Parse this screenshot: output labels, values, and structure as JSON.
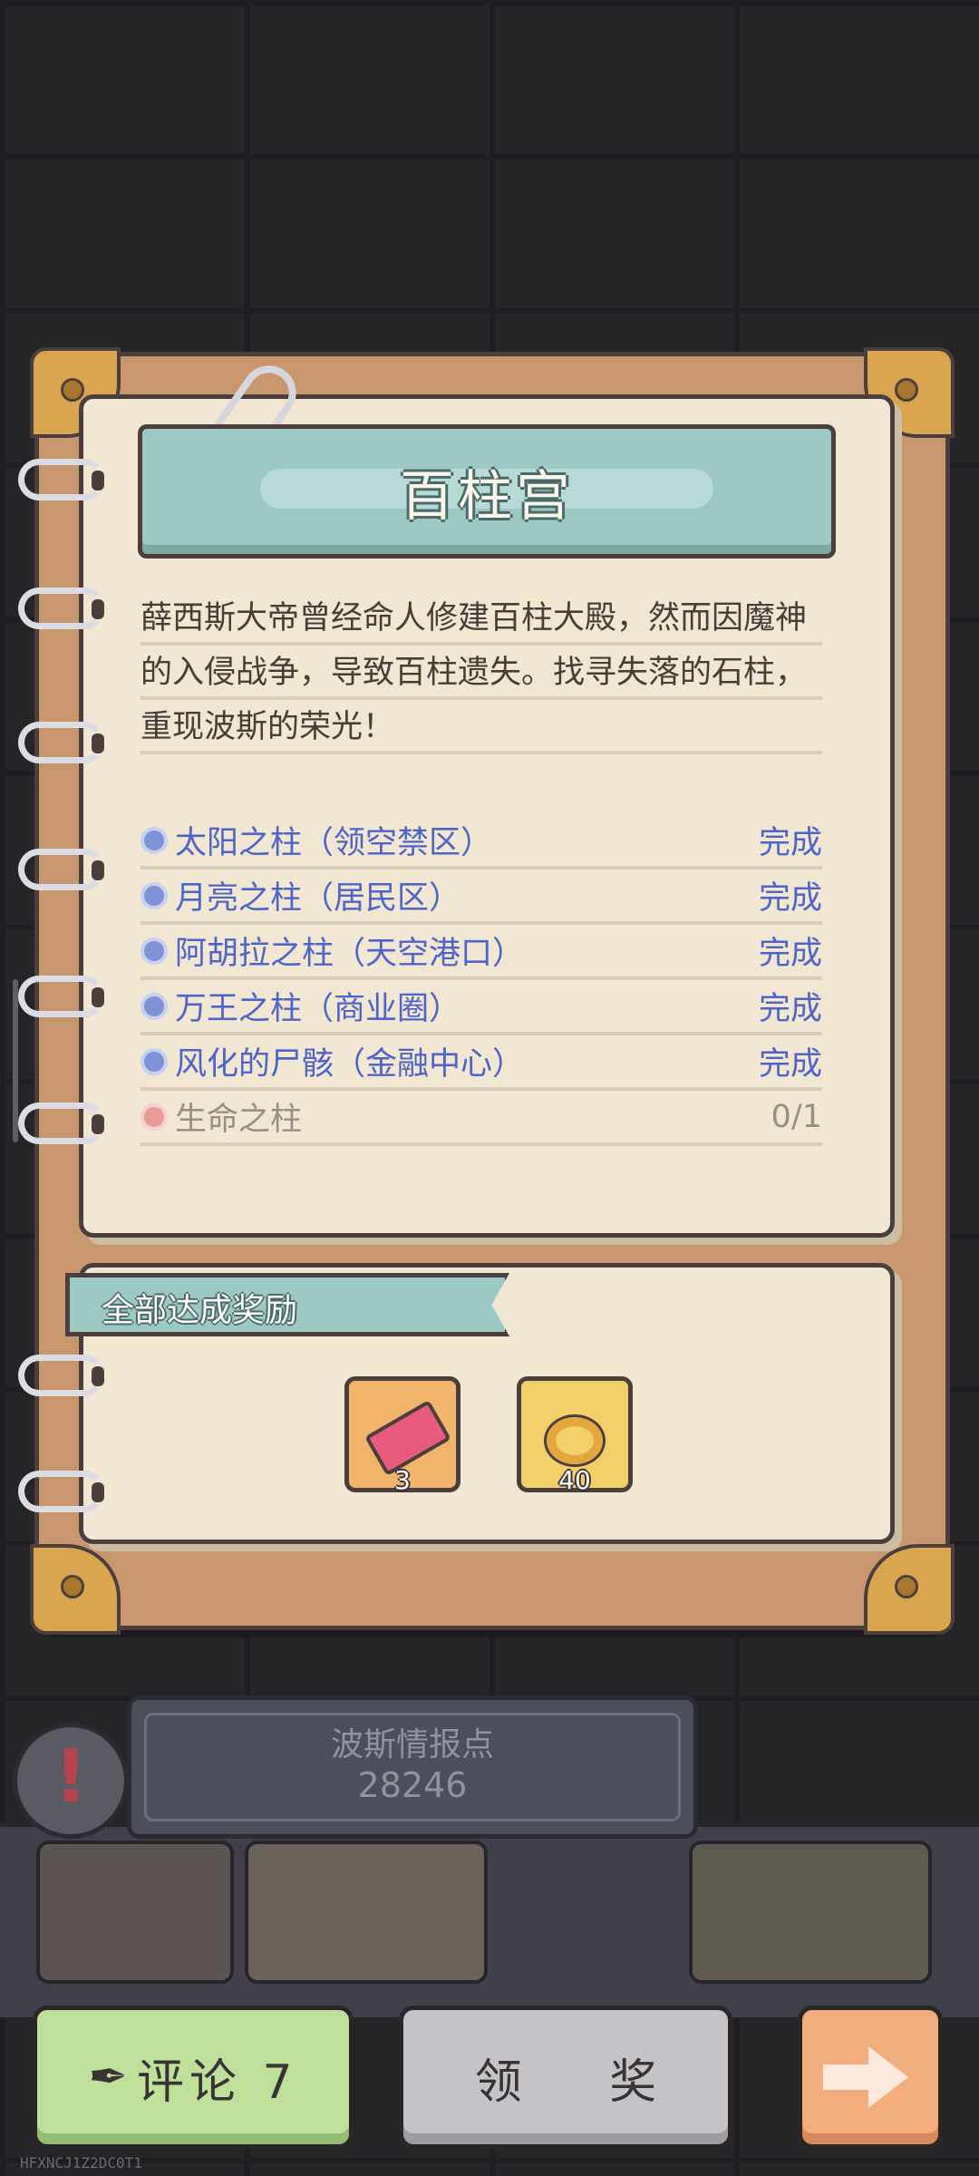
{
  "title": "百柱宫",
  "description": "薛西斯大帝曾经命人修建百柱大殿，然而因魔神的入侵战争，导致百柱遗失。找寻失落的石柱，重现波斯的荣光！",
  "quests": [
    {
      "name": "太阳之柱（领空禁区）",
      "status": "完成"
    },
    {
      "name": "月亮之柱（居民区）",
      "status": "完成"
    },
    {
      "name": "阿胡拉之柱（天空港口）",
      "status": "完成"
    },
    {
      "name": "万王之柱（商业圈）",
      "status": "完成"
    },
    {
      "name": "风化的尸骸（金融中心）",
      "status": "完成"
    },
    {
      "name": "生命之柱",
      "status": "0/1"
    }
  ],
  "reward": {
    "label": "全部达成奖励",
    "items": [
      {
        "icon": "ticket-icon",
        "count": "3"
      },
      {
        "icon": "gold-ring-icon",
        "count": "40"
      }
    ]
  },
  "intel": {
    "label": "波斯情报点",
    "value": "28246"
  },
  "buttons": {
    "comment": "评论 7",
    "claim": "领 奖"
  },
  "watermark": "HFXNCJ1Z2DC0T1",
  "colors": {
    "done": "#4e64c8",
    "pending": "#9a8e85",
    "banner": "#9cc9c4",
    "paper": "#f1e7d3"
  }
}
